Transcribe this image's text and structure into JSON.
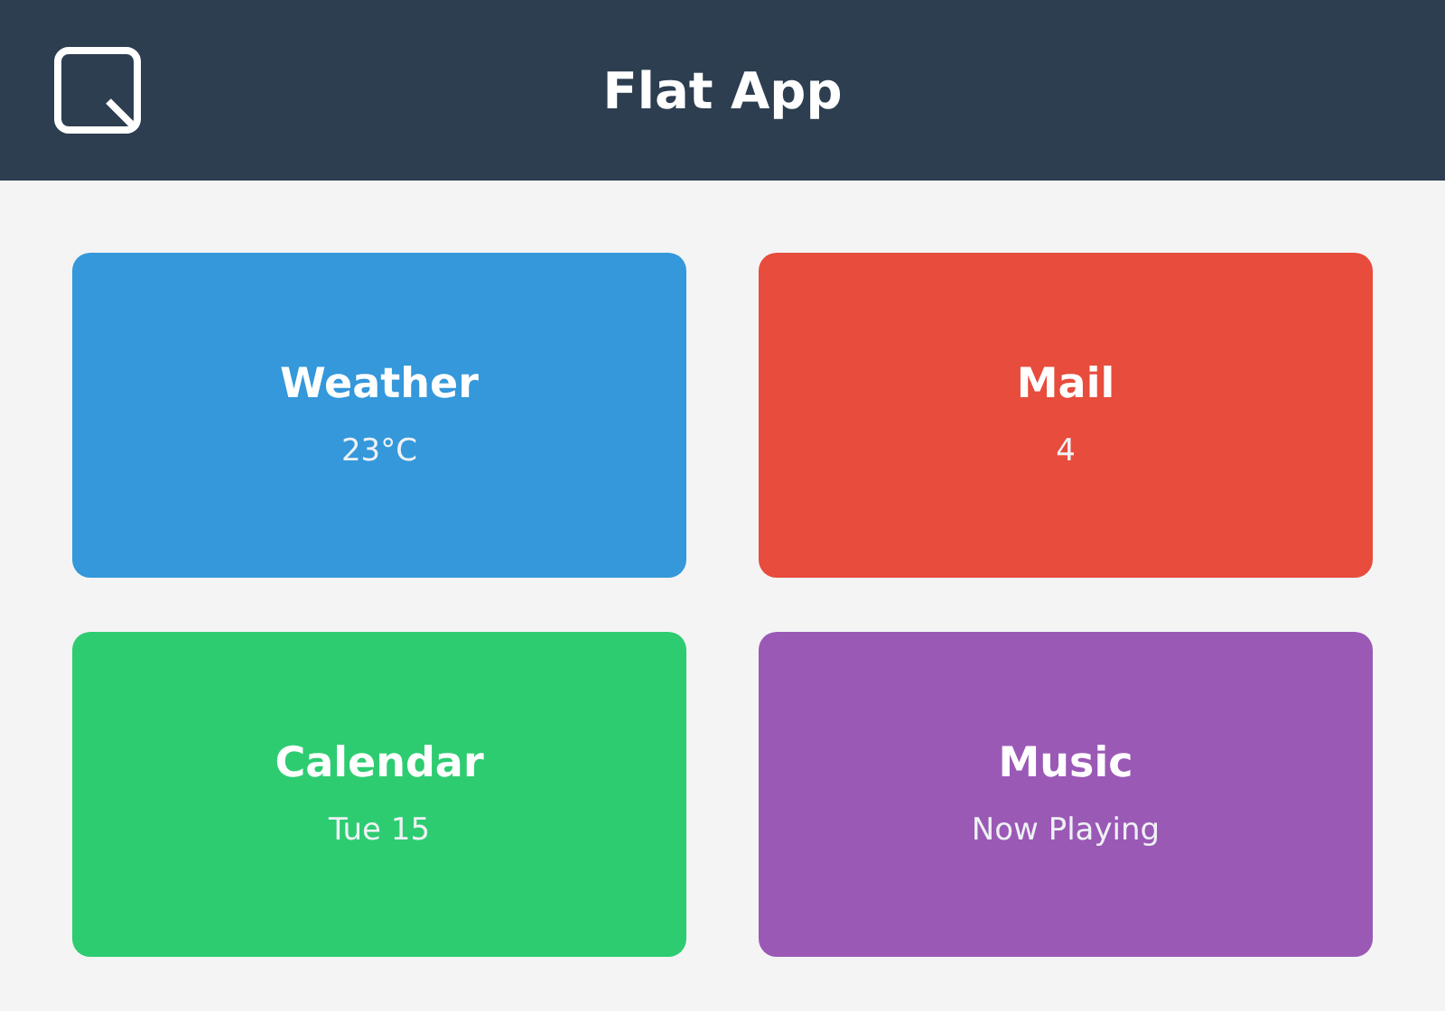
{
  "header": {
    "title": "Flat App"
  },
  "tiles": [
    {
      "title": "Weather",
      "subtitle": "23°C",
      "color": "#3498db"
    },
    {
      "title": "Mail",
      "subtitle": "4",
      "color": "#e74c3c"
    },
    {
      "title": "Calendar",
      "subtitle": "Tue 15",
      "color": "#2ecc71"
    },
    {
      "title": "Music",
      "subtitle": "Now Playing",
      "color": "#9b59b6"
    }
  ]
}
